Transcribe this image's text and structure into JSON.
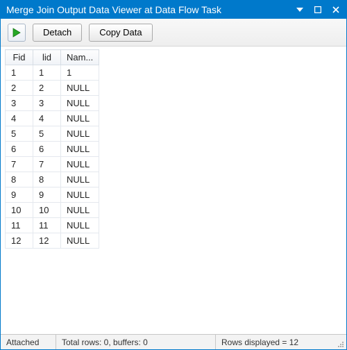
{
  "titlebar": {
    "title": "Merge Join Output Data Viewer at Data Flow Task"
  },
  "toolbar": {
    "detach_label": "Detach",
    "copy_label": "Copy Data"
  },
  "grid": {
    "columns": [
      "Fid",
      "lid",
      "Nam..."
    ],
    "rows": [
      [
        "1",
        "1",
        "1"
      ],
      [
        "2",
        "2",
        "NULL"
      ],
      [
        "3",
        "3",
        "NULL"
      ],
      [
        "4",
        "4",
        "NULL"
      ],
      [
        "5",
        "5",
        "NULL"
      ],
      [
        "6",
        "6",
        "NULL"
      ],
      [
        "7",
        "7",
        "NULL"
      ],
      [
        "8",
        "8",
        "NULL"
      ],
      [
        "9",
        "9",
        "NULL"
      ],
      [
        "10",
        "10",
        "NULL"
      ],
      [
        "11",
        "11",
        "NULL"
      ],
      [
        "12",
        "12",
        "NULL"
      ]
    ]
  },
  "status": {
    "attached": "Attached",
    "totals": "Total rows: 0, buffers: 0",
    "displayed": "Rows displayed = 12"
  }
}
